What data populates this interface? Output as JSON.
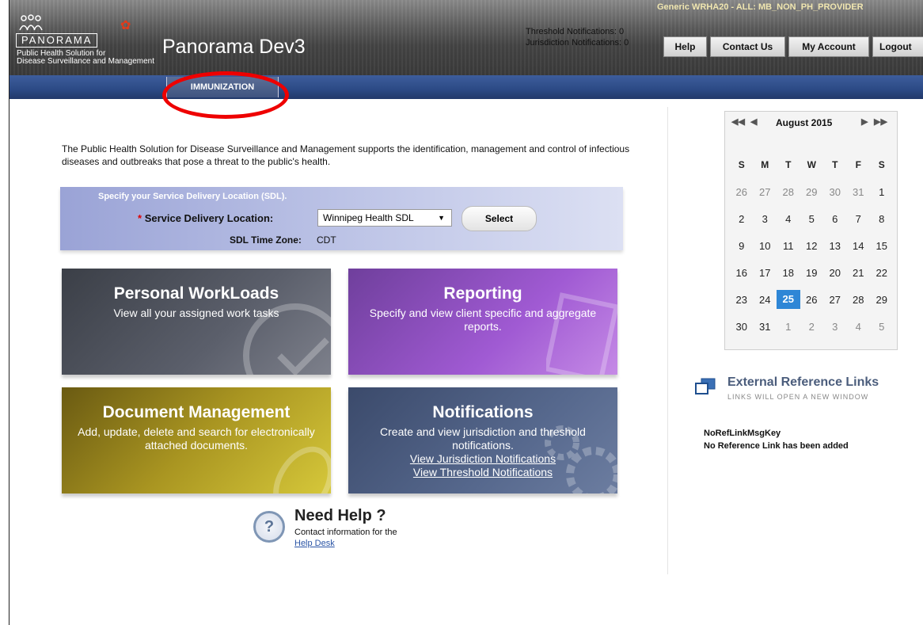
{
  "header": {
    "logo_word": "PANORAMA",
    "logo_tagline": "Public Health Solution for",
    "logo_tagline2": "Disease Surveillance and Management",
    "app_title": "Panorama Dev3",
    "threshold_notifications": "Threshold Notifications: 0",
    "jurisdiction_notifications": "Jurisdiction Notifications: 0",
    "user": "Generic WRHA20 - ALL: MB_NON_PH_PROVIDER",
    "buttons": {
      "help": "Help",
      "contact": "Contact Us",
      "account": "My Account",
      "logout": "Logout"
    }
  },
  "nav": {
    "tab": "IMMUNIZATION"
  },
  "intro": "The Public Health Solution for Disease Surveillance and Management supports the identification, management and control of infectious diseases and outbreaks that pose a threat to the public's health.",
  "sdl": {
    "prompt": "Specify your Service Delivery Location (SDL).",
    "required_mark": "*",
    "label": "Service Delivery Location:",
    "value": "Winnipeg Health SDL",
    "button": "Select",
    "tz_label": "SDL Time Zone:",
    "tz_value": "CDT"
  },
  "tiles": {
    "work": {
      "title": "Personal WorkLoads",
      "desc": "View all your assigned work tasks"
    },
    "report": {
      "title": "Reporting",
      "desc": "Specify and view client specific and aggregate reports."
    },
    "doc": {
      "title": "Document Management",
      "desc": "Add, update, delete and search for electronically attached documents."
    },
    "notif": {
      "title": "Notifications",
      "desc": "Create and view jurisdiction and threshold notifications.",
      "link1": "View Jurisdiction Notifications",
      "link2": "View Threshold Notifications"
    }
  },
  "help": {
    "icon": "?",
    "title": "Need Help ?",
    "text": "Contact information for the",
    "link": "Help Desk"
  },
  "calendar": {
    "title": "August 2015",
    "days_of_week": [
      "S",
      "M",
      "T",
      "W",
      "T",
      "F",
      "S"
    ],
    "weeks": [
      [
        "26",
        "27",
        "28",
        "29",
        "30",
        "31",
        "1"
      ],
      [
        "2",
        "3",
        "4",
        "5",
        "6",
        "7",
        "8"
      ],
      [
        "9",
        "10",
        "11",
        "12",
        "13",
        "14",
        "15"
      ],
      [
        "16",
        "17",
        "18",
        "19",
        "20",
        "21",
        "22"
      ],
      [
        "23",
        "24",
        "25",
        "26",
        "27",
        "28",
        "29"
      ],
      [
        "30",
        "31",
        "1",
        "2",
        "3",
        "4",
        "5"
      ]
    ],
    "today": "25"
  },
  "external": {
    "title": "External Reference Links",
    "subtitle": "LINKS WILL OPEN A NEW WINDOW",
    "key": "NoRefLinkMsgKey",
    "message": "No Reference Link has been added"
  },
  "colors": {
    "accent_red": "#e00000",
    "nav_blue": "#2c4a85",
    "today_blue": "#2e86d6"
  }
}
